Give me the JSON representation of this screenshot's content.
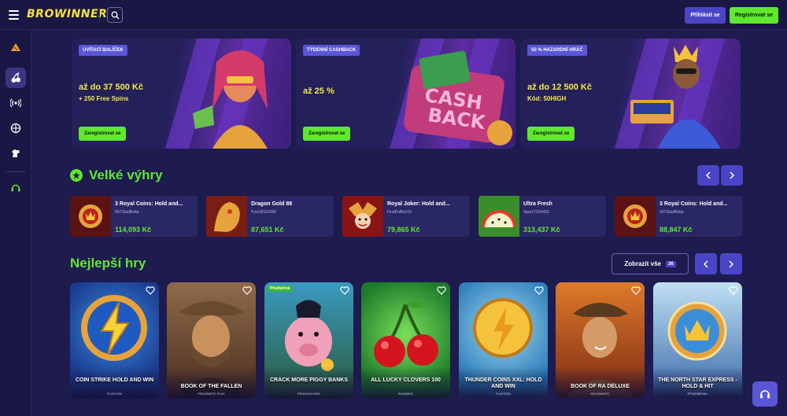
{
  "header": {
    "logo": "BROWINNER",
    "login_label": "Přihlásit se",
    "register_label": "Registrovat se"
  },
  "banners": [
    {
      "tag": "Uvítací balíček",
      "line1": "až do 37 500 Kč",
      "line2": "+ 250 Free Spins",
      "cta": "Zaregistrovat se"
    },
    {
      "tag": "Týdenní cashback",
      "line1": "až 25 %",
      "line2": "",
      "cta": "Zaregistrovat se",
      "art_text": [
        "CASH",
        "BACK"
      ]
    },
    {
      "tag": "50 % hazardní hráč",
      "line1": "až do 12 500 Kč",
      "line2": "Kód: 50HIGH",
      "cta": "Zaregistrovat se"
    }
  ],
  "big_wins": {
    "title": "Velké výhry",
    "items": [
      {
        "game": "3 Royal Coins: Hold and...",
        "user": "507GladBetta",
        "amount": "114,093 Kč"
      },
      {
        "game": "Dragon Gold 88",
        "user": "Pyro38110992",
        "amount": "87,651 Kč"
      },
      {
        "game": "Royal Joker: Hold and...",
        "user": "FirstPuffin103",
        "amount": "79,865 Kč"
      },
      {
        "game": "Ultra Fresh",
        "user": "Spar17624423",
        "amount": "313,437 Kč"
      },
      {
        "game": "3 Royal Coins: Hold and...",
        "user": "507GladBetta",
        "amount": "88,847 Kč"
      }
    ]
  },
  "top_games": {
    "title": "Nejlepší hry",
    "show_all_label": "Zobrazit vše",
    "show_all_count": "36",
    "items": [
      {
        "name": "COIN STRIKE HOLD AND WIN",
        "provider": "PLAYSON",
        "badge": ""
      },
      {
        "name": "BOOK OF THE FALLEN",
        "provider": "PRAGMATIC PLAY",
        "badge": ""
      },
      {
        "name": "CRACK MORE PIGGY BANKS",
        "provider": "PENGUIN KING",
        "badge": "Předběžná"
      },
      {
        "name": "ALL LUCKY CLOVERS 100",
        "provider": "BGAMING",
        "badge": ""
      },
      {
        "name": "THUNDER COINS XXL: HOLD AND WIN",
        "provider": "PLAYSON",
        "badge": ""
      },
      {
        "name": "BOOK OF RA DELUXE",
        "provider": "NOVOMATIC",
        "badge": ""
      },
      {
        "name": "THE NORTH STAR EXPRESS - HOLD & HIT",
        "provider": "SPINOMENAL",
        "badge": ""
      }
    ]
  },
  "colors": {
    "accent_green": "#5ee82e",
    "primary_purple": "#4a44c7",
    "background": "#1e1b4f",
    "logo_yellow": "#f2e33b"
  }
}
